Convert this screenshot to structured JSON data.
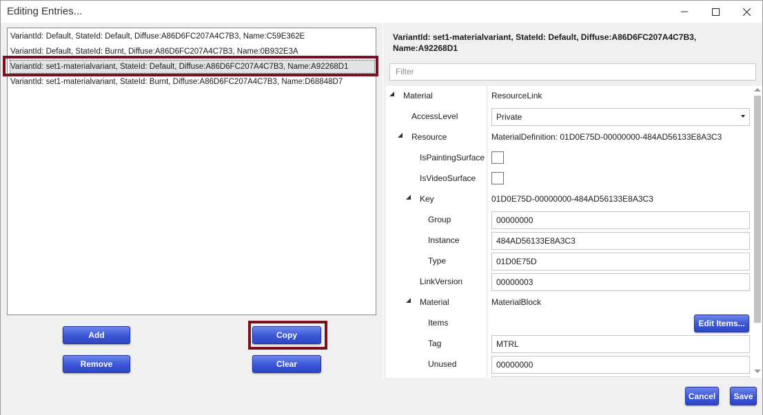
{
  "window": {
    "title": "Editing Entries...",
    "minimize_icon": "minimize-icon",
    "maximize_icon": "maximize-icon",
    "close_icon": "close-icon"
  },
  "entries": [
    {
      "text": "VariantId: Default, StateId: Default, Diffuse:A86D6FC207A4C7B3, Name:C59E362E"
    },
    {
      "text": "VariantId: Default, StateId: Burnt, Diffuse:A86D6FC207A4C7B3, Name:0B932E3A"
    },
    {
      "text": "VariantId: set1-materialvariant, StateId: Default, Diffuse:A86D6FC207A4C7B3, Name:A92268D1"
    },
    {
      "text": "VariantId: set1-materialvariant, StateId: Burnt, Diffuse:A86D6FC207A4C7B3, Name:D68848D7"
    }
  ],
  "selected_index": 2,
  "buttons": {
    "add": "Add",
    "copy": "Copy",
    "remove": "Remove",
    "clear": "Clear",
    "edit_items": "Edit Items...",
    "cancel": "Cancel",
    "save": "Save"
  },
  "details": {
    "header": "VariantId: set1-materialvariant, StateId: Default, Diffuse:A86D6FC207A4C7B3, Name:A92268D1",
    "filter_placeholder": "Filter"
  },
  "properties": {
    "material": {
      "name": "Material",
      "value": "ResourceLink"
    },
    "access_level": {
      "name": "AccessLevel",
      "value": "Private"
    },
    "resource": {
      "name": "Resource",
      "value": "MaterialDefinition: 01D0E75D-00000000-484AD56133E8A3C3"
    },
    "is_painting_surface": {
      "name": "IsPaintingSurface"
    },
    "is_video_surface": {
      "name": "IsVideoSurface"
    },
    "key": {
      "name": "Key",
      "value": "01D0E75D-00000000-484AD56133E8A3C3"
    },
    "group": {
      "name": "Group",
      "value": "00000000"
    },
    "instance": {
      "name": "Instance",
      "value": "484AD56133E8A3C3"
    },
    "type": {
      "name": "Type",
      "value": "01D0E75D"
    },
    "link_version": {
      "name": "LinkVersion",
      "value": "00000003"
    },
    "material_block": {
      "name": "Material",
      "value": "MaterialBlock"
    },
    "items": {
      "name": "Items"
    },
    "tag": {
      "name": "Tag",
      "value": "MTRL"
    },
    "unused": {
      "name": "Unused",
      "value": "00000000"
    }
  },
  "colors": {
    "button_blue": "#3a55d6",
    "highlight": "#7a1120"
  }
}
